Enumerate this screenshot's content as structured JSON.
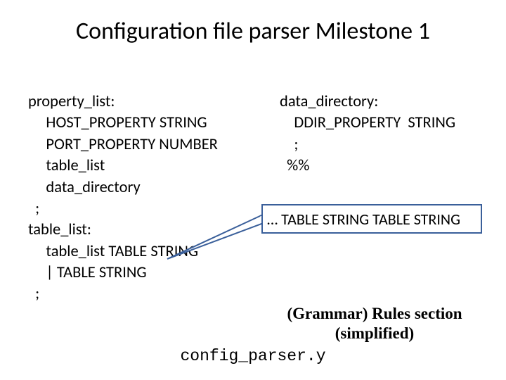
{
  "title": "Configuration file parser Milestone 1",
  "left": {
    "l1": "property_list:",
    "l2": "     HOST_PROPERTY STRING",
    "l3": "     PORT_PROPERTY NUMBER",
    "l4": "     table_list",
    "l5": "     data_directory",
    "l6": "  ;",
    "l7": "table_list:",
    "l8": "     table_list TABLE STRING",
    "l9": "     | TABLE STRING",
    "l10": "  ;"
  },
  "right": {
    "r1": "data_directory:",
    "r2": "    DDIR_PROPERTY  STRING",
    "r3": "    ;",
    "r4": "  %%"
  },
  "callout": "… TABLE STRING  TABLE STRING",
  "caption_l1": "(Grammar) Rules section",
  "caption_l2": "(simplified)",
  "filename": "config_parser.y"
}
